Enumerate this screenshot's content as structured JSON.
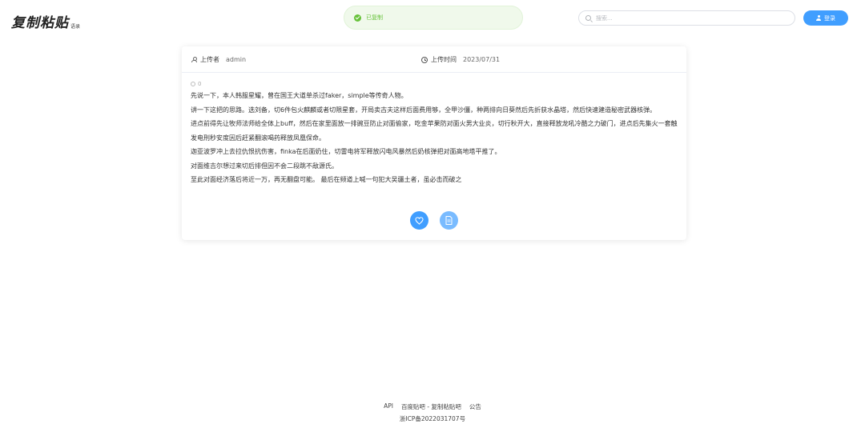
{
  "header": {
    "logo_main": "复制粘贴",
    "logo_sub": "语录",
    "toast_text": "已复制",
    "search_placeholder": "搜索...",
    "login_label": "登录"
  },
  "post": {
    "uploader_label": "上传者",
    "uploader_value": "admin",
    "time_label": "上传时间",
    "time_value": "2023/07/31",
    "like_count": "0",
    "paragraphs": [
      "先说一下，本人韩服星耀，曾在国王大道单杀过faker，simple等传奇人物。",
      "讲一下这把的思路。选刘备，切6件包火麒麟或者切限星套，开局卖古夫这样后面费用够，全甲沙僵，种两排向日葵然后先折获水晶塔，然后快速建造秘密武器核弹。",
      "进点前得先让牧师法师给全体上buff，然后在家里面放一排豌豆防止对面偷家，吃金苹果防对面火男大业炎，切行秋开大，直接释放龙吼冷酷之力破门，进点后先集火一套触发电刑秒安度因后赶紧翻滚喝药释放凤凰保命。",
      "迦亚波罗冲上去拉仇恨抗伤害，finka在后面奶住，切雷电将军释放闪电风暴然后奶核弹把对面高地塔平推了。",
      "对面维吉尔想过来切后排但因不会二段跳不敌源氏。",
      "至此对面经济落后将近一万，再无翻盘可能。 最后在频道上喊一句犯大吴疆土者，虽必击而破之"
    ]
  },
  "footer": {
    "links": [
      "API",
      "百度贴吧 - 复制粘贴吧",
      "公告"
    ],
    "icp": "浙ICP备2022031707号"
  },
  "colors": {
    "primary": "#409eff",
    "success": "#67c23a",
    "toast_bg": "#f0f9eb"
  },
  "icons": {
    "toast": "check-circle-icon",
    "search": "search-icon",
    "login": "user-icon",
    "uploader": "person-icon",
    "time": "clock-icon",
    "like": "heart-icon",
    "copy": "document-icon"
  }
}
